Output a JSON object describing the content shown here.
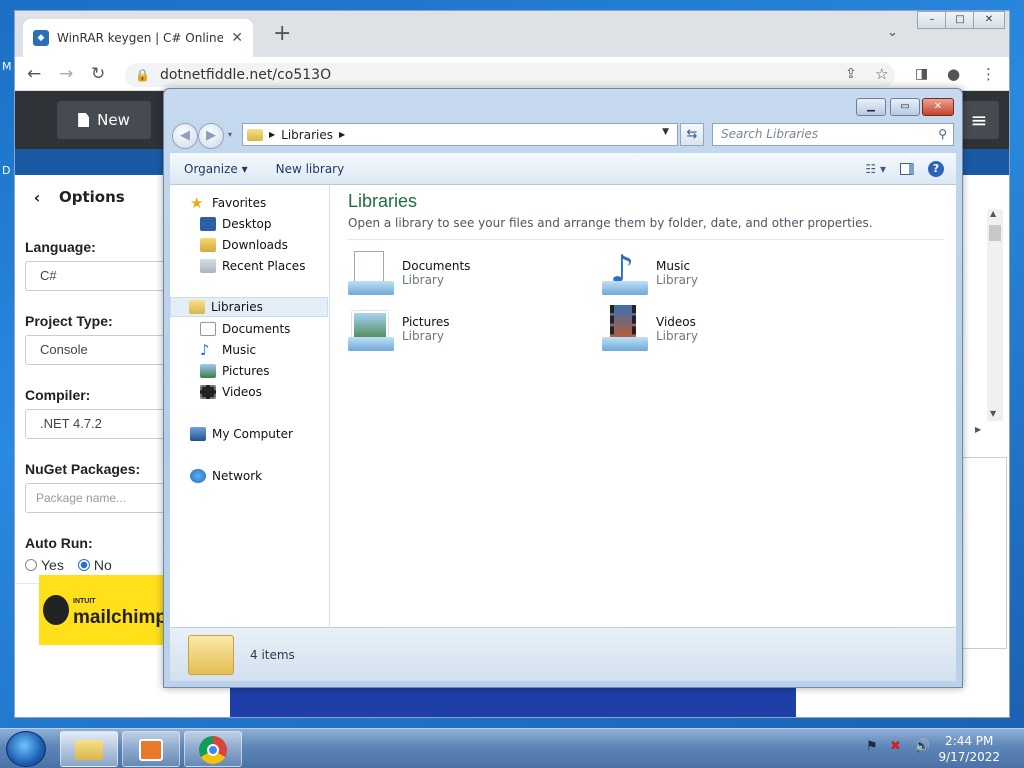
{
  "desktop": {
    "mark1": "M",
    "mark2": "D"
  },
  "browser": {
    "tab_title": "WinRAR keygen | C# Online Com",
    "tab_close": "✕",
    "new_tab": "+",
    "tab_menu": "⌄",
    "url": "dotnetfiddle.net/co513O",
    "win_min": "–",
    "win_max": "□",
    "win_close": "✕"
  },
  "fiddle": {
    "new_label": "New",
    "options_title": "Options",
    "back": "‹",
    "hamburger": "≡",
    "language_label": "Language:",
    "language_value": "C#",
    "project_type_label": "Project Type:",
    "project_type_value": "Console",
    "compiler_label": "Compiler:",
    "compiler_value": ".NET 4.7.2",
    "nuget_label": "NuGet Packages:",
    "nuget_placeholder": "Package name...",
    "autorun_label": "Auto Run:",
    "autorun_yes": "Yes",
    "autorun_no": "No",
    "autorun_selected": "No",
    "ad_small": "INTUIT",
    "ad_text": "mailchimp"
  },
  "explorer": {
    "address_root": "Libraries",
    "search_placeholder": "Search Libraries",
    "organize": "Organize ▾",
    "new_library": "New library",
    "nav": {
      "favorites": "Favorites",
      "desktop": "Desktop",
      "downloads": "Downloads",
      "recent_places": "Recent Places",
      "libraries": "Libraries",
      "documents": "Documents",
      "music": "Music",
      "pictures": "Pictures",
      "videos": "Videos",
      "my_computer": "My Computer",
      "network": "Network"
    },
    "content_title": "Libraries",
    "content_subtitle": "Open a library to see your files and arrange them by folder, date, and other properties.",
    "libraries": [
      {
        "name": "Documents",
        "type": "Library"
      },
      {
        "name": "Music",
        "type": "Library"
      },
      {
        "name": "Pictures",
        "type": "Library"
      },
      {
        "name": "Videos",
        "type": "Library"
      }
    ],
    "status_count": "4 items"
  },
  "taskbar": {
    "time": "2:44 PM",
    "date": "9/17/2022"
  },
  "colors": {
    "library_title": "#1d6f3e",
    "fiddle_bar": "#2f3338",
    "mailchimp_yellow": "#ffe01b"
  }
}
